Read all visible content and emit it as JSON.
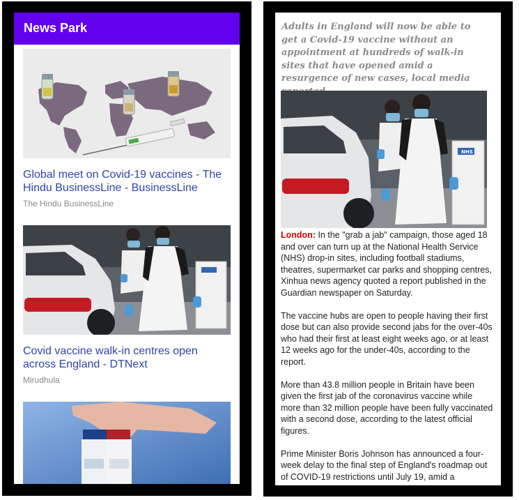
{
  "left_screen": {
    "app_title": "News Park",
    "articles": [
      {
        "title": "Global meet on Covid-19 vaccines - The Hindu BusinessLine - BusinessLine",
        "source": "The Hindu BusinessLine"
      },
      {
        "title": "Covid vaccine walk-in centres open across England - DTNext",
        "source": "Mirudhula"
      }
    ]
  },
  "right_screen": {
    "lead": "Adults in England will now be able to get a Covid-19 vaccine without an appointment at hundreds of walk-in sites that have opened amid a resurgence of new cases, local media reported.",
    "dateline": "London:",
    "paragraphs": [
      " In the \"grab a jab\" campaign, those aged 18 and over can turn up at the National Health Service (NHS) drop-in sites, including football stadiums, theatres, supermarket car parks and shopping centres, Xinhua news agency quoted a report published in the Guardian newspaper on Saturday.",
      "The vaccine hubs are open to people having their first dose but can also provide second jabs for the over-40s who had their first at least eight weeks ago, or at least 12 weeks ago for the under-40s, according to the report.",
      "More than 43.8 million people in Britain have been given the first jab of the coronavirus vaccine while more than 32 million people have been fully vaccinated with a second dose, according to the latest official figures.",
      "Prime Minister Boris Johnson has announced a four-week delay to the final step of England's roadmap out of COVID-19 restrictions until July 19, amid a"
    ],
    "image_sign_text": "NHS"
  },
  "colors": {
    "appbar": "#6200ee",
    "link": "#2f44a6",
    "dateline": "#d40000"
  }
}
